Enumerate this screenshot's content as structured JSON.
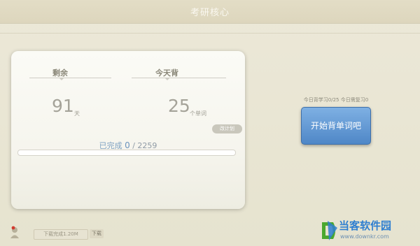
{
  "header": {
    "title": "考研核心"
  },
  "card": {
    "remaining": {
      "label": "剩余",
      "value": "91",
      "unit": "天"
    },
    "today": {
      "label": "今天背",
      "value": "25",
      "unit": "个单词"
    },
    "change_plan_label": "改计划",
    "progress": {
      "label": "已完成",
      "done": "0",
      "separator": " / ",
      "total": "2259",
      "fraction": 0
    }
  },
  "today_status": "今日背学习0/25 今日需复习0",
  "start_button_label": "开始背单词吧",
  "footer": {
    "download_status": "下载完成1.20M",
    "download_button": "下载"
  },
  "watermark": {
    "text": "当客软件园",
    "url": "www.downkr.com"
  },
  "colors": {
    "accent": "#4f87c7",
    "progress": "#7ea2c2"
  }
}
